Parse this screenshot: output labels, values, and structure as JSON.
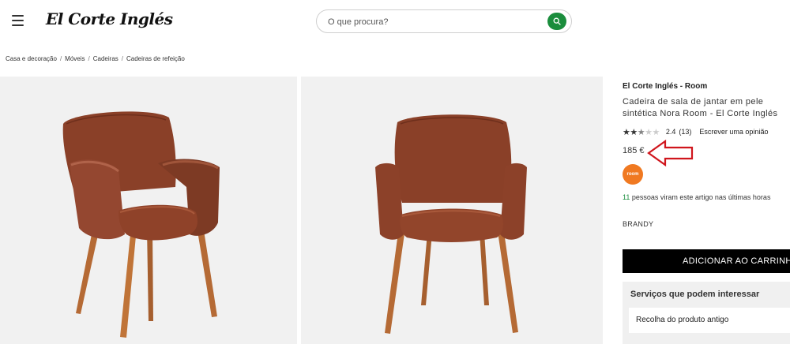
{
  "header": {
    "logo_text": "El Corte Inglés",
    "search_placeholder": "O que procura?"
  },
  "breadcrumb": [
    "Casa e decoração",
    "Móveis",
    "Cadeiras",
    "Cadeiras de refeição"
  ],
  "product": {
    "brand": "El Corte Inglés - Room",
    "title": "Cadeira de sala de jantar em pele sintética Nora Room - El Corte Inglés",
    "rating_value": "2.4",
    "rating_count": "(13)",
    "rating_stars": 2.4,
    "review_link": "Escrever uma opinião",
    "price": "185 €",
    "badge_text": "room",
    "viewers_number": "11",
    "viewers_text": "pessoas viram este artigo nas últimas horas",
    "color": "BRANDY",
    "add_to_cart": "ADICIONAR AO CARRINHO"
  },
  "services": {
    "title": "Serviços que podem interessar",
    "items": [
      "Recolha do produto antigo"
    ]
  },
  "colors": {
    "accent_green": "#1a8d3c",
    "annotation_red": "#d0161d",
    "room_orange": "#f07921",
    "chair_leather": "#8a4028",
    "chair_legs": "#b56a35"
  }
}
